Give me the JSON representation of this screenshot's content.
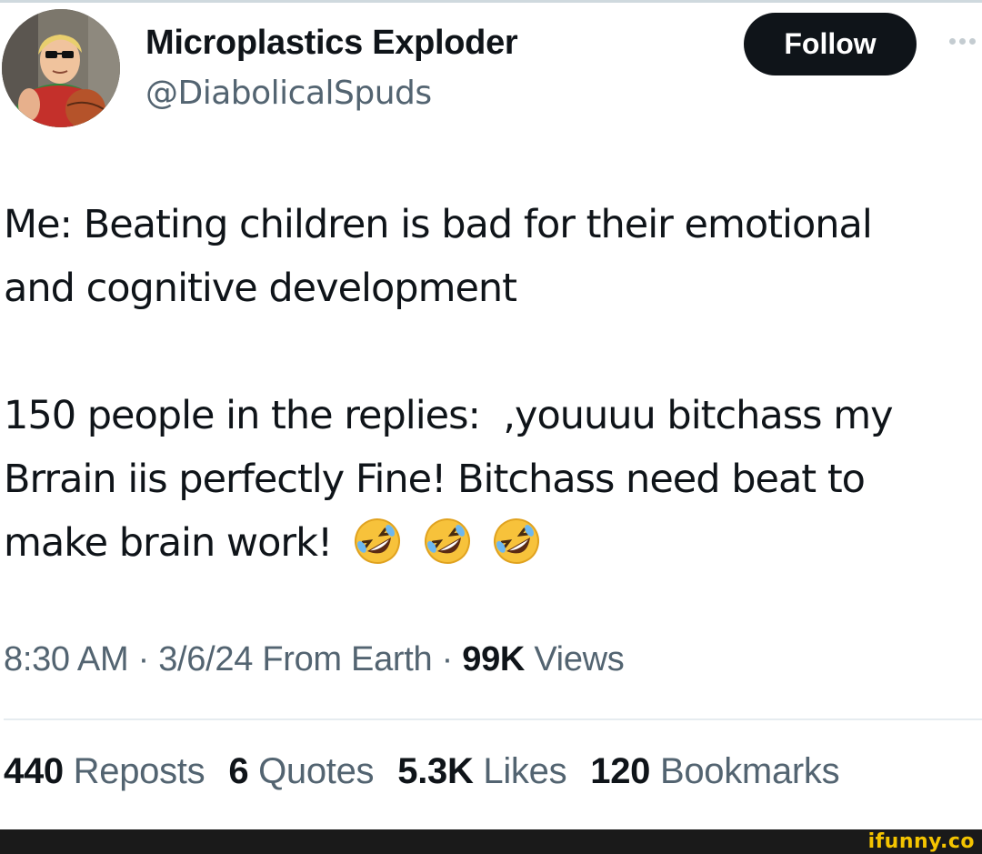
{
  "author": {
    "display_name": "Microplastics Exploder",
    "handle": "@DiabolicalSpuds",
    "avatar_icon": "user-avatar"
  },
  "actions": {
    "follow_label": "Follow",
    "more_icon": "more-horizontal-icon"
  },
  "tweet": {
    "line1": "Me: Beating children is bad for their emotional",
    "line2": "and cognitive development",
    "line3": "150 people in the replies:  ,youuuu bitchass my",
    "line4": "Brrain iis perfectly Fine! Bitchass need beat to",
    "line5": "make brain work!",
    "emojis": [
      "rolling-on-floor-laughing-emoji",
      "rolling-on-floor-laughing-emoji",
      "rolling-on-floor-laughing-emoji"
    ]
  },
  "meta": {
    "time": "8:30 AM",
    "separator": " · ",
    "date": "3/6/24",
    "location": "From Earth",
    "views_count": "99K",
    "views_label": "Views"
  },
  "stats": [
    {
      "count": "440",
      "label": "Reposts"
    },
    {
      "count": "6",
      "label": "Quotes"
    },
    {
      "count": "5.3K",
      "label": "Likes"
    },
    {
      "count": "120",
      "label": "Bookmarks"
    }
  ],
  "watermark": "ifunny.co",
  "colors": {
    "text_primary": "#0f1419",
    "text_secondary": "#536471",
    "follow_bg": "#0f1419",
    "watermark": "#f4c400"
  }
}
